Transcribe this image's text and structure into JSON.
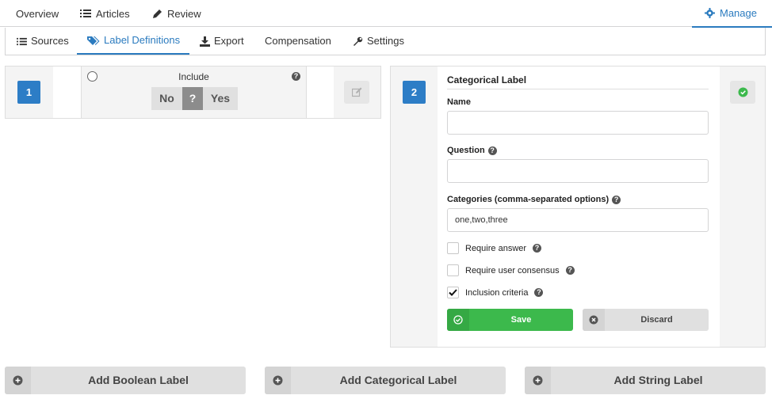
{
  "top_nav": {
    "overview": "Overview",
    "articles": "Articles",
    "review": "Review",
    "manage": "Manage"
  },
  "sub_nav": {
    "sources": "Sources",
    "label_definitions": "Label Definitions",
    "export": "Export",
    "compensation": "Compensation",
    "settings": "Settings"
  },
  "label1": {
    "number": "1",
    "name": "Include",
    "options": {
      "no": "No",
      "unknown": "?",
      "yes": "Yes"
    }
  },
  "label2": {
    "number": "2",
    "title": "Categorical Label",
    "name_label": "Name",
    "name_value": "",
    "question_label": "Question",
    "question_value": "",
    "categories_label": "Categories (comma-separated options)",
    "categories_value": "one,two,three",
    "require_answer": {
      "label": "Require answer",
      "checked": false
    },
    "require_consensus": {
      "label": "Require user consensus",
      "checked": false
    },
    "inclusion_criteria": {
      "label": "Inclusion criteria",
      "checked": true
    },
    "save_label": "Save",
    "discard_label": "Discard"
  },
  "add_buttons": {
    "boolean": "Add Boolean Label",
    "categorical": "Add Categorical Label",
    "string": "Add String Label"
  },
  "colors": {
    "accent": "#2b7bbf",
    "badge": "#2d7dc6",
    "save": "#3cb94c"
  }
}
